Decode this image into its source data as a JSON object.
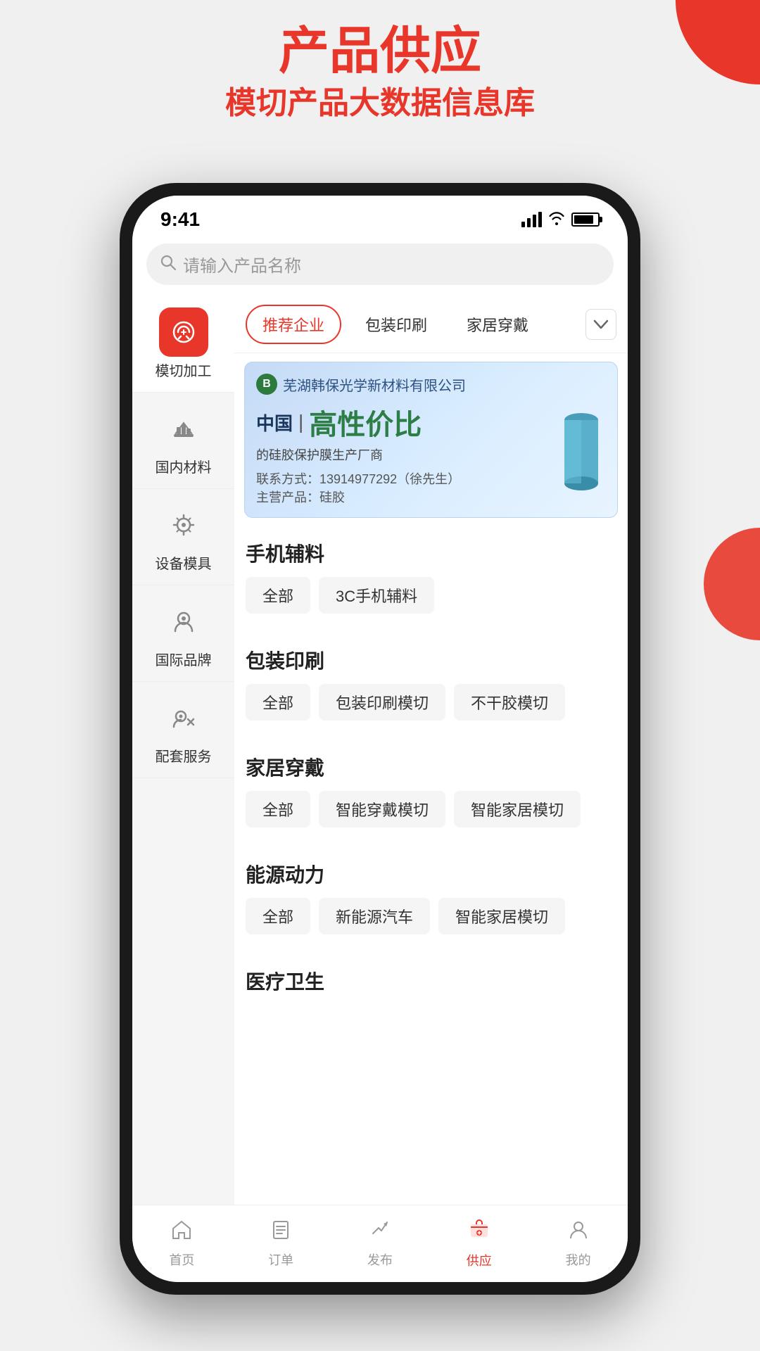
{
  "hero": {
    "title": "产品供应",
    "subtitle": "模切产品大数据信息库"
  },
  "status_bar": {
    "time": "9:41"
  },
  "search": {
    "placeholder": "请输入产品名称"
  },
  "sidebar": {
    "items": [
      {
        "label": "模切加工",
        "icon": "tool",
        "active": true
      },
      {
        "label": "国内材料",
        "icon": "material",
        "active": false
      },
      {
        "label": "设备模具",
        "icon": "equipment",
        "active": false
      },
      {
        "label": "国际品牌",
        "icon": "brand",
        "active": false
      },
      {
        "label": "配套服务",
        "icon": "service",
        "active": false
      }
    ]
  },
  "tabs": [
    {
      "label": "推荐企业",
      "active": true
    },
    {
      "label": "包装印刷",
      "active": false
    },
    {
      "label": "家居穿戴",
      "active": false
    }
  ],
  "banner": {
    "company": "芜湖韩保光学新材料有限公司",
    "company_icon": "B",
    "china_text": "中国",
    "highlight_text": "高性价比",
    "desc_text": "的硅胶保护膜生产厂商",
    "contact": "联系方式：13914977292（徐先生）",
    "main_product_label": "主营产品：硅胶"
  },
  "categories": [
    {
      "title": "手机辅料",
      "tags": [
        "全部",
        "3C手机辅料"
      ]
    },
    {
      "title": "包装印刷",
      "tags": [
        "全部",
        "包装印刷模切",
        "不干胶模切"
      ]
    },
    {
      "title": "家居穿戴",
      "tags": [
        "全部",
        "智能穿戴模切",
        "智能家居模切"
      ]
    },
    {
      "title": "能源动力",
      "tags": [
        "全部",
        "新能源汽车",
        "智能家居模切"
      ]
    },
    {
      "title": "医疗卫生",
      "tags": []
    }
  ],
  "bottom_nav": [
    {
      "label": "首页",
      "icon": "home",
      "active": false
    },
    {
      "label": "订单",
      "icon": "order",
      "active": false
    },
    {
      "label": "发布",
      "icon": "publish",
      "active": false
    },
    {
      "label": "供应",
      "icon": "supply",
      "active": true
    },
    {
      "label": "我的",
      "icon": "profile",
      "active": false
    }
  ]
}
